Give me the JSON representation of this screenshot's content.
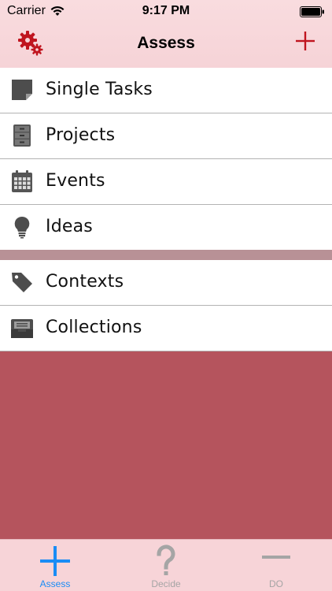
{
  "status_bar": {
    "carrier": "Carrier",
    "time": "9:17 PM",
    "icons": [
      "wifi-icon",
      "battery-icon"
    ]
  },
  "nav_bar": {
    "title": "Assess",
    "left_icon": "gears-icon",
    "right_icon": "plus-icon",
    "accent_color": "#c0151f"
  },
  "lists": {
    "primary": [
      {
        "label": "Single Tasks",
        "icon": "sticky-note-icon"
      },
      {
        "label": "Projects",
        "icon": "file-cabinet-icon"
      },
      {
        "label": "Events",
        "icon": "calendar-icon"
      },
      {
        "label": "Ideas",
        "icon": "lightbulb-icon"
      }
    ],
    "secondary": [
      {
        "label": "Contexts",
        "icon": "tag-icon"
      },
      {
        "label": "Collections",
        "icon": "inbox-tray-icon"
      }
    ]
  },
  "tab_bar": {
    "tabs": [
      {
        "label": "Assess",
        "icon": "plus-icon",
        "selected": true
      },
      {
        "label": "Decide",
        "icon": "question-mark-icon",
        "selected": false
      },
      {
        "label": "DO",
        "icon": "minus-icon",
        "selected": false
      }
    ],
    "selected_color": "#1a8cf5",
    "inactive_color": "#a5a5a5"
  },
  "colors": {
    "header_bg": "#f7d4d8",
    "band": "#b89196",
    "content_bg": "#b5545d"
  }
}
